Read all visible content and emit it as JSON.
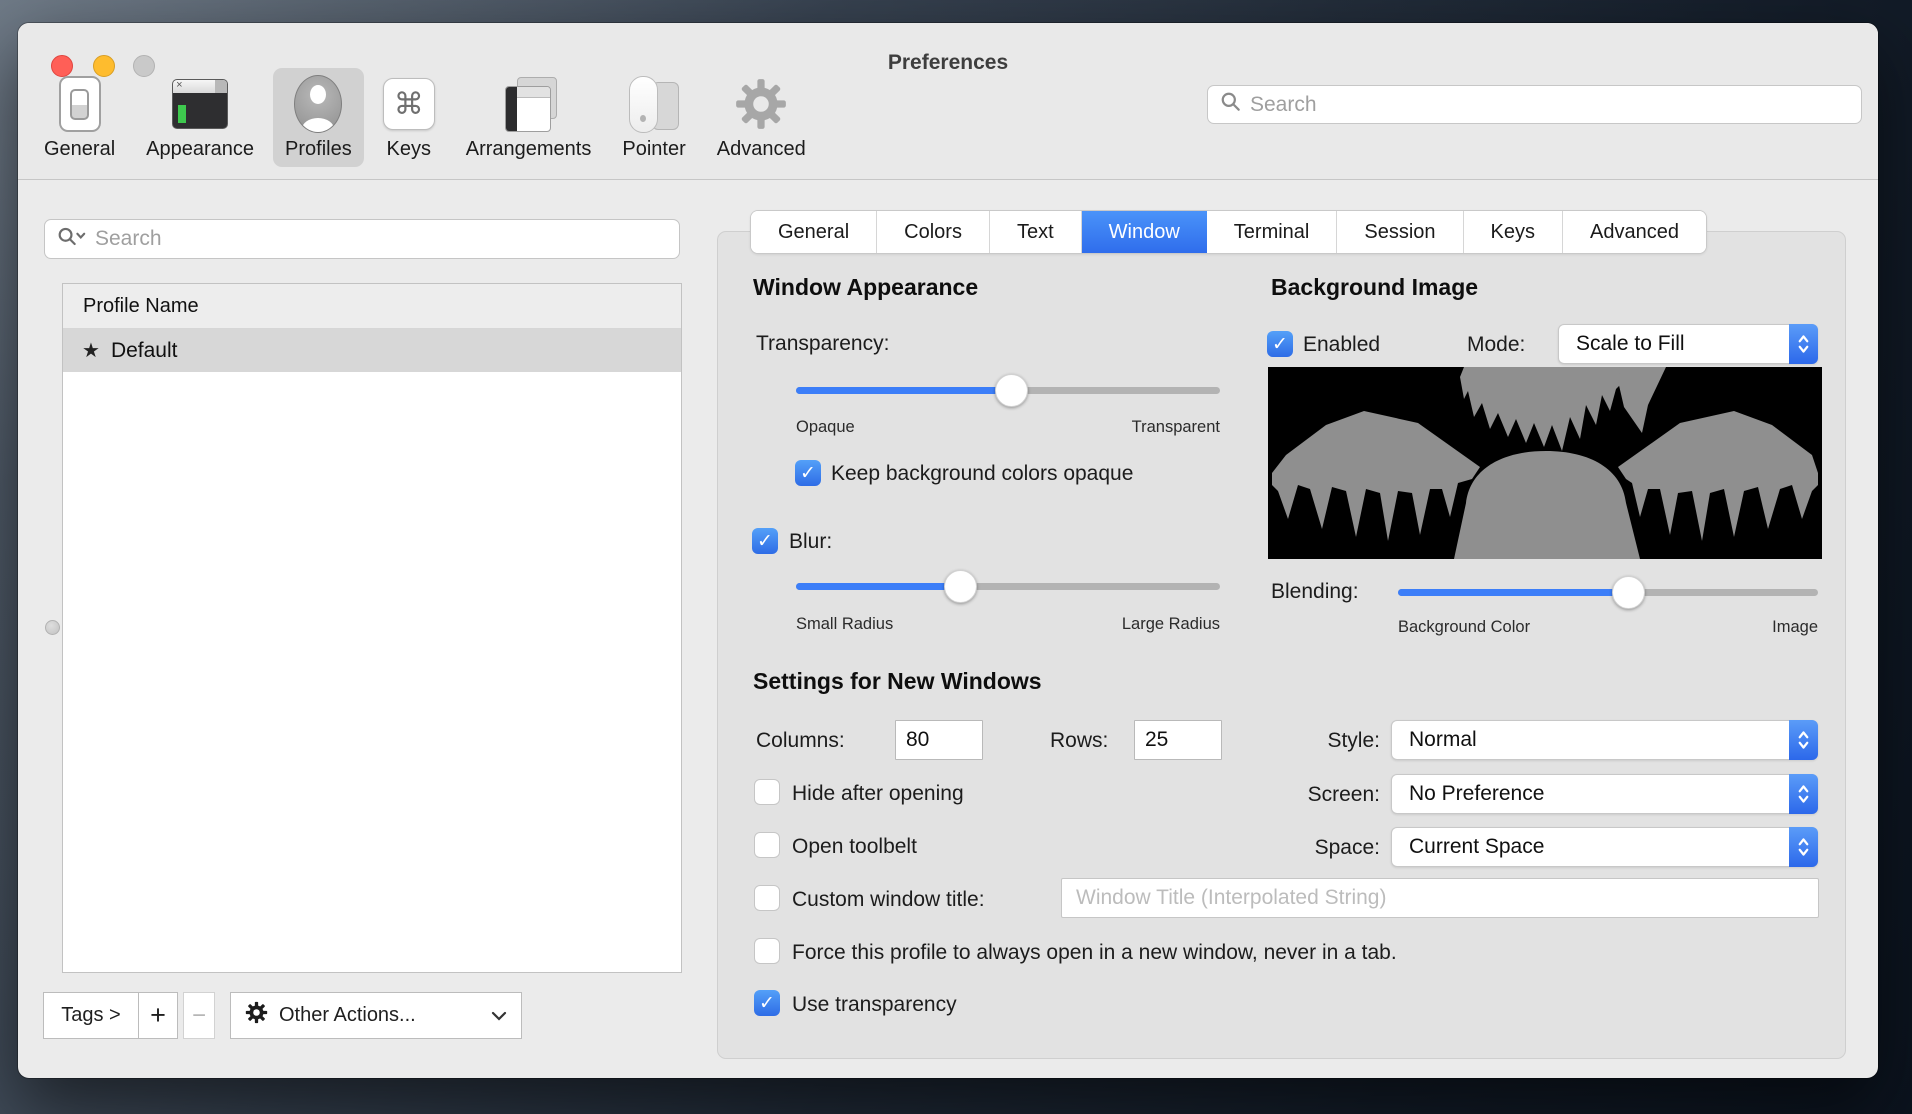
{
  "titlebar": {
    "title": "Preferences"
  },
  "toolbar": {
    "items": [
      {
        "label": "General"
      },
      {
        "label": "Appearance"
      },
      {
        "label": "Profiles"
      },
      {
        "label": "Keys"
      },
      {
        "label": "Arrangements"
      },
      {
        "label": "Pointer"
      },
      {
        "label": "Advanced"
      }
    ],
    "selected_item": "Profiles",
    "search_placeholder": "Search"
  },
  "sidebar": {
    "search_placeholder": "Search",
    "list_header": "Profile Name",
    "profiles": [
      {
        "star": "★",
        "name": "Default",
        "selected": true
      }
    ],
    "tags_label": "Tags >",
    "add_label": "+",
    "remove_label": "−",
    "other_actions_label": "Other Actions..."
  },
  "tabs": {
    "items": [
      "General",
      "Colors",
      "Text",
      "Window",
      "Terminal",
      "Session",
      "Keys",
      "Advanced"
    ],
    "selected": "Window"
  },
  "panel": {
    "window_appearance": {
      "heading": "Window Appearance",
      "transparency_label": "Transparency:",
      "transparency_pct": 51,
      "opaque_label": "Opaque",
      "transparent_label": "Transparent",
      "keep_opaque": {
        "label": "Keep background colors opaque",
        "checked": true
      },
      "blur": {
        "label": "Blur:",
        "checked": true,
        "pct": 39,
        "small_label": "Small Radius",
        "large_label": "Large Radius"
      }
    },
    "background_image": {
      "heading": "Background Image",
      "enabled": {
        "label": "Enabled",
        "checked": true
      },
      "mode_label": "Mode:",
      "mode_value": "Scale to Fill",
      "blending_label": "Blending:",
      "blending_pct": 55,
      "blend_min_label": "Background Color",
      "blend_max_label": "Image"
    },
    "new_windows": {
      "heading": "Settings for New Windows",
      "columns_label": "Columns:",
      "columns_value": "80",
      "rows_label": "Rows:",
      "rows_value": "25",
      "style_label": "Style:",
      "style_value": "Normal",
      "screen_label": "Screen:",
      "screen_value": "No Preference",
      "space_label": "Space:",
      "space_value": "Current Space",
      "hide_after_opening": {
        "label": "Hide after opening",
        "checked": false
      },
      "open_toolbelt": {
        "label": "Open toolbelt",
        "checked": false
      },
      "custom_window_title": {
        "label": "Custom window title:",
        "checked": false,
        "placeholder": "Window Title (Interpolated String)"
      },
      "force_new_window": {
        "label": "Force this profile to always open in a new window, never in a tab.",
        "checked": false
      },
      "use_transparency": {
        "label": "Use transparency",
        "checked": true
      }
    }
  },
  "colors": {
    "accent": "#3b7df8",
    "selected_tab": "#3a7df2",
    "window_bg": "#ebebeb",
    "panel_bg": "#e2e2e2"
  }
}
